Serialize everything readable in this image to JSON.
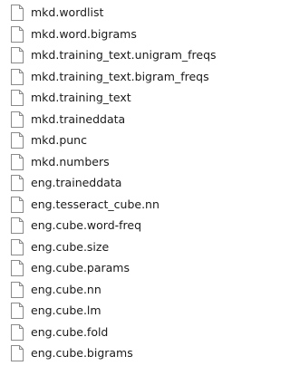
{
  "files": [
    {
      "name": "mkd.wordlist",
      "icon": "generic-file-icon"
    },
    {
      "name": "mkd.word.bigrams",
      "icon": "generic-file-icon"
    },
    {
      "name": "mkd.training_text.unigram_freqs",
      "icon": "generic-file-icon"
    },
    {
      "name": "mkd.training_text.bigram_freqs",
      "icon": "generic-file-icon"
    },
    {
      "name": "mkd.training_text",
      "icon": "generic-file-icon"
    },
    {
      "name": "mkd.traineddata",
      "icon": "generic-file-icon"
    },
    {
      "name": "mkd.punc",
      "icon": "generic-file-icon"
    },
    {
      "name": "mkd.numbers",
      "icon": "generic-file-icon"
    },
    {
      "name": "eng.traineddata",
      "icon": "generic-file-icon"
    },
    {
      "name": "eng.tesseract_cube.nn",
      "icon": "generic-file-icon"
    },
    {
      "name": "eng.cube.word-freq",
      "icon": "generic-file-icon"
    },
    {
      "name": "eng.cube.size",
      "icon": "generic-file-icon"
    },
    {
      "name": "eng.cube.params",
      "icon": "generic-file-icon"
    },
    {
      "name": "eng.cube.nn",
      "icon": "generic-file-icon"
    },
    {
      "name": "eng.cube.lm",
      "icon": "generic-file-icon"
    },
    {
      "name": "eng.cube.fold",
      "icon": "generic-file-icon"
    },
    {
      "name": "eng.cube.bigrams",
      "icon": "generic-file-icon"
    }
  ],
  "colors": {
    "text": "#1a1a1a",
    "icon_outline": "#8a8a8a",
    "icon_fill": "#ffffff",
    "background": "#ffffff"
  }
}
